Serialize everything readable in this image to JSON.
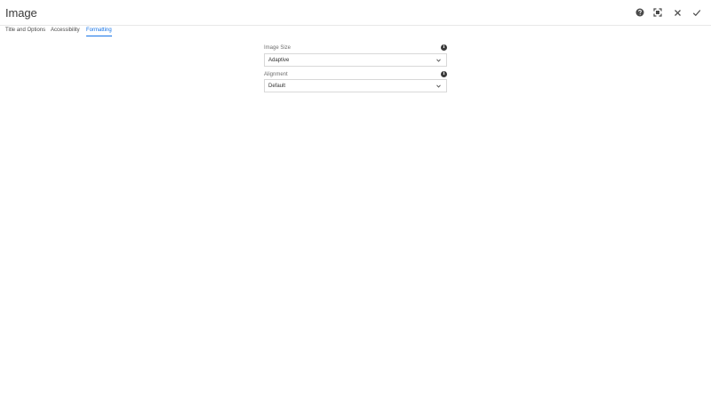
{
  "dialog": {
    "title": "Image"
  },
  "header_actions": [
    {
      "name": "help",
      "icon": "help-icon"
    },
    {
      "name": "fullscreen",
      "icon": "fullscreen-icon"
    },
    {
      "name": "close",
      "icon": "close-icon"
    },
    {
      "name": "done",
      "icon": "checkmark-icon"
    }
  ],
  "tabs": [
    {
      "label": "Title and Options",
      "active": false
    },
    {
      "label": "Accessibility",
      "active": false
    },
    {
      "label": "Formatting",
      "active": true
    }
  ],
  "fields": {
    "image_size": {
      "label": "Image Size",
      "value": "Adaptive",
      "info_icon": "info-icon"
    },
    "alignment": {
      "label": "Alignment",
      "value": "Default",
      "info_icon": "info-icon"
    }
  },
  "colors": {
    "accent": "#1473e6",
    "text": "#323232",
    "border": "#d8d8d8"
  }
}
